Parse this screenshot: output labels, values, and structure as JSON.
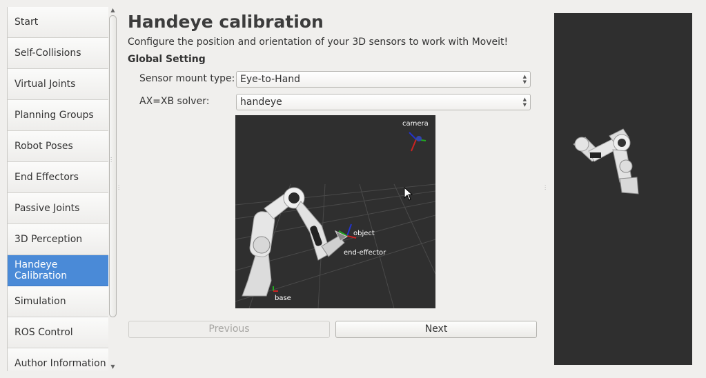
{
  "sidebar": {
    "items": [
      {
        "label": "Start",
        "active": false
      },
      {
        "label": "Self-Collisions",
        "active": false
      },
      {
        "label": "Virtual Joints",
        "active": false
      },
      {
        "label": "Planning Groups",
        "active": false
      },
      {
        "label": "Robot Poses",
        "active": false
      },
      {
        "label": "End Effectors",
        "active": false
      },
      {
        "label": "Passive Joints",
        "active": false
      },
      {
        "label": "3D Perception",
        "active": false
      },
      {
        "label": "Handeye Calibration",
        "active": true
      },
      {
        "label": "Simulation",
        "active": false
      },
      {
        "label": "ROS Control",
        "active": false
      },
      {
        "label": "Author Information",
        "active": false
      }
    ]
  },
  "main": {
    "title": "Handeye calibration",
    "description": "Configure the position and orientation of your 3D sensors to work with Moveit!",
    "section_title": "Global Setting",
    "sensor_mount_label": "Sensor mount type:",
    "sensor_mount_value": "Eye-to-Hand",
    "solver_label": "AX=XB solver:",
    "solver_value": "handeye",
    "viewer": {
      "camera_label": "camera",
      "object_label": "object",
      "end_effector_label": "end-effector",
      "base_label": "base"
    },
    "previous_label": "Previous",
    "next_label": "Next"
  },
  "colors": {
    "accent": "#4a8ad7",
    "viewer_bg": "#2f2f2f"
  }
}
